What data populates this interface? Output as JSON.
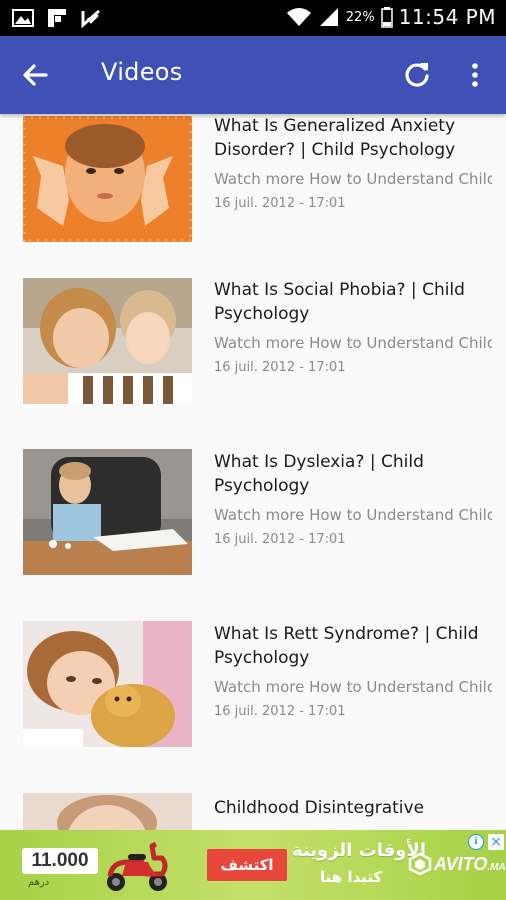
{
  "status_bar": {
    "battery": "22%",
    "time": "11:54 PM"
  },
  "app_bar": {
    "title": "Videos"
  },
  "videos": [
    {
      "title": "What Is Generalized Anxiety Disorder? | Child Psychology",
      "description": "Watch more How to Understand Child Psychology videos: http:/...",
      "date": "16 juil. 2012 - 17:01"
    },
    {
      "title": "What Is Social Phobia? | Child Psychology",
      "description": "Watch more How to Understand Child Psychology videos: http:/...",
      "date": "16 juil. 2012 - 17:01"
    },
    {
      "title": "What Is Dyslexia? | Child Psychology",
      "description": "Watch more How to Understand Child Psychology videos: http:/...",
      "date": "16 juil. 2012 - 17:01"
    },
    {
      "title": "What Is Rett Syndrome? | Child Psychology",
      "description": "Watch more How to Understand Child Psychology videos: http:/...",
      "date": "16 juil. 2012 - 17:01"
    },
    {
      "title": "Childhood Disintegrative",
      "description": "",
      "date": ""
    }
  ],
  "ad": {
    "price": "11.000",
    "currency": "درهم",
    "cta": "اكتشف",
    "headline": "الأوقات الزوينة",
    "subline": "كتبدا هنا",
    "logo": "AVITO",
    "logo_suffix": ".MA",
    "info": "i",
    "close": "×"
  },
  "colors": {
    "app_bar": "#3f51b5",
    "ad_cta": "#e8483c",
    "ad_bg": "#a6d146"
  }
}
